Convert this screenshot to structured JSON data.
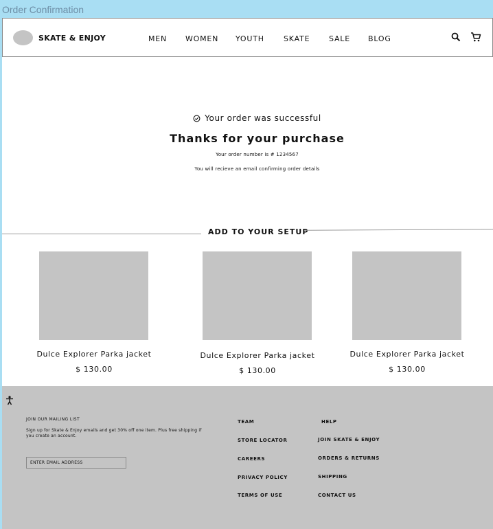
{
  "frame_title": "Order Confirmation",
  "header": {
    "brand": "SKATE & ENJOY",
    "nav": [
      "MEN",
      "WOMEN",
      "YOUTH",
      "SKATE",
      "SALE",
      "BLOG"
    ],
    "icons": [
      "search-icon",
      "cart-icon"
    ]
  },
  "confirmation": {
    "status": "Your order was successful",
    "heading": "Thanks for your purchase",
    "order_number": "Your order number is # 1234567",
    "email_note": "You will recieve an email confirming order details"
  },
  "upsell": {
    "title": "ADD TO YOUR SETUP",
    "products": [
      {
        "name": "Dulce Explorer Parka jacket",
        "price": "$ 130.00"
      },
      {
        "name": "Dulce Explorer Parka jacket",
        "price": "$ 130.00"
      },
      {
        "name": "Dulce Explorer Parka jacket",
        "price": "$ 130.00"
      }
    ]
  },
  "footer": {
    "mailing_title": "JOIN OUR MAILING LIST",
    "mailing_desc": "Sign up for Skate & Enjoy emails and get 30% off one item. Plus free shipping if you create an account.",
    "email_placeholder": "ENTER EMAIL ADDRESS",
    "col1": [
      "TEAM",
      "STORE LOCATOR",
      "CAREERS",
      "PRIVACY POLICY",
      "TERMS OF USE"
    ],
    "col2": [
      "HELP",
      "JOIN SKATE & ENJOY",
      "ORDERS & RETURNS",
      "SHIPPING",
      "CONTACT US"
    ]
  },
  "colors": {
    "canvas_bg": "#a9def3",
    "placeholder_gray": "#c4c4c4",
    "footer_bg": "#c4c4c4"
  }
}
